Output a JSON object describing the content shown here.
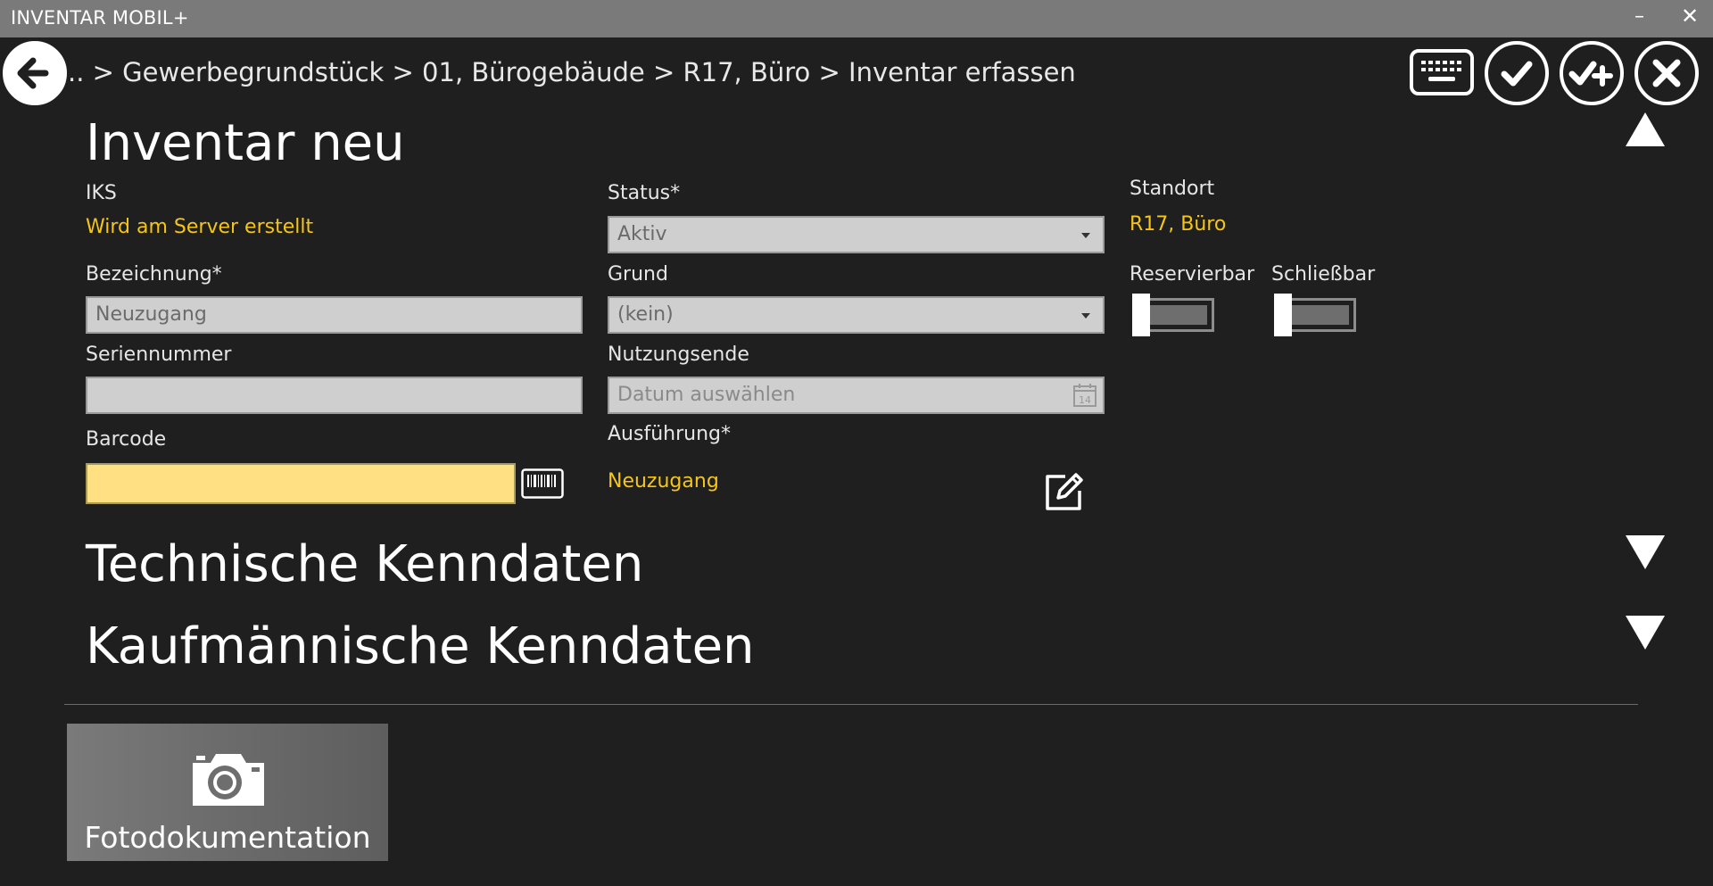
{
  "window": {
    "title": "INVENTAR MOBIL+",
    "minimize_label": "–",
    "close_label": "✕"
  },
  "nav": {
    "breadcrumb": ".. > Gewerbegrundstück > 01, Bürogebäude > R17, Büro > Inventar erfassen",
    "icons": [
      "back-arrow-icon",
      "keyboard-icon",
      "checkmark-icon",
      "checkmark-plus-icon",
      "close-icon"
    ]
  },
  "sections": {
    "inventar": "Inventar neu",
    "technisch": "Technische Kenndaten",
    "kaufmaennisch": "Kaufmännische Kenndaten"
  },
  "form": {
    "iks": {
      "label": "IKS",
      "value": "Wird am Server erstellt"
    },
    "bezeichnung": {
      "label": "Bezeichnung*",
      "value": "Neuzugang"
    },
    "seriennummer": {
      "label": "Seriennummer",
      "value": ""
    },
    "barcode": {
      "label": "Barcode",
      "value": ""
    },
    "status": {
      "label": "Status*",
      "value": "Aktiv"
    },
    "grund": {
      "label": "Grund",
      "value": "(kein)"
    },
    "nutzungsende": {
      "label": "Nutzungsende",
      "placeholder": "Datum auswählen",
      "calendar_day": "14"
    },
    "ausfuehrung": {
      "label": "Ausführung*",
      "value": "Neuzugang"
    },
    "standort": {
      "label": "Standort",
      "value": "R17, Büro"
    },
    "reservierbar": {
      "label": "Reservierbar",
      "on": false
    },
    "schliessbar": {
      "label": "Schließbar",
      "on": false
    }
  },
  "photo": {
    "label": "Fotodokumentation"
  },
  "colors": {
    "background": "#1f1f1f",
    "titlebar": "#7a7a7a",
    "accent_value": "#f5c518",
    "barcode_field": "#ffe082",
    "input_field": "#cfcfcf"
  }
}
